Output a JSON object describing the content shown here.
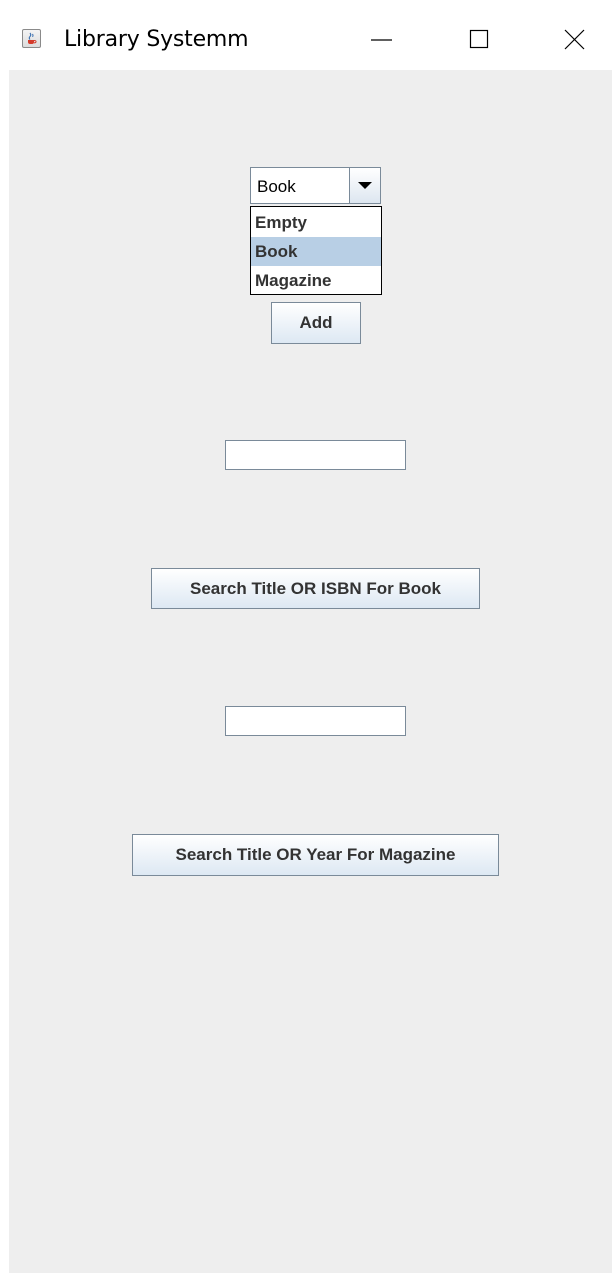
{
  "window": {
    "title": "Library Systemm",
    "icon": "java-cup-icon",
    "controls": [
      "minimize-icon",
      "maximize-icon",
      "close-icon"
    ]
  },
  "item_type": {
    "selected": "Book",
    "options": [
      "Empty",
      "Book",
      "Magazine"
    ],
    "highlighted_option": "Book"
  },
  "add_button": {
    "label": "Add"
  },
  "book_search": {
    "input_value": "",
    "button_label": "Search Title OR ISBN For Book"
  },
  "magazine_search": {
    "input_value": "",
    "button_label": "Search Title OR Year For Magazine"
  },
  "colors": {
    "content_background": "#eeeeee",
    "selection_highlight": "#b8cfe5",
    "button_gradient_bottom": "#dde8f3",
    "border": "#7a8a99"
  }
}
